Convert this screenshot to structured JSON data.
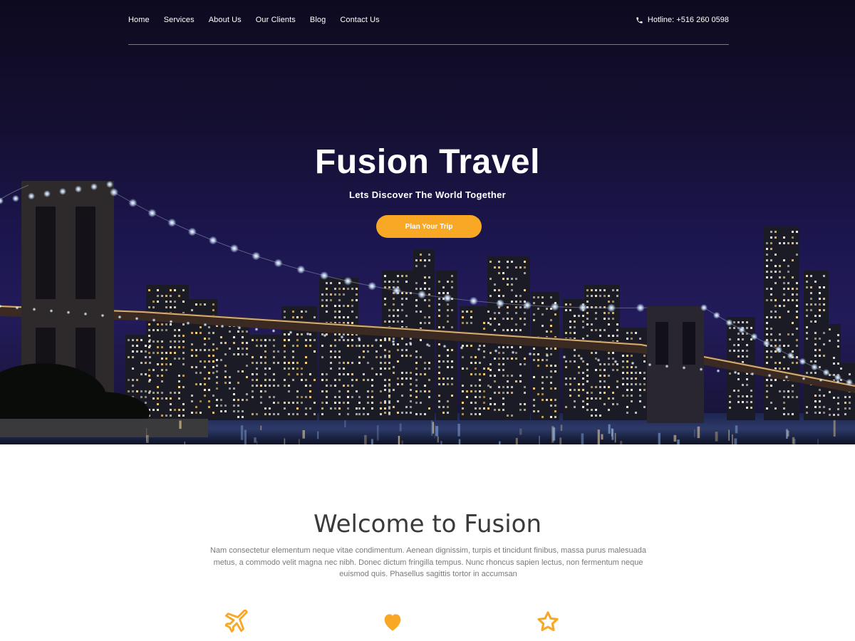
{
  "nav": {
    "items": [
      "Home",
      "Services",
      "About Us",
      "Our Clients",
      "Blog",
      "Contact Us"
    ],
    "hotline": "Hotline: +516 260 0598"
  },
  "hero": {
    "title": "Fusion Travel",
    "subtitle": "Lets Discover The World Together",
    "cta_label": "Plan Your Trip"
  },
  "welcome": {
    "title": "Welcome to Fusion",
    "text": "Nam consectetur elementum neque vitae condimentum. Aenean dignissim, turpis et tincidunt finibus, massa purus malesuada metus, a commodo velit magna nec nibh. Donec dictum fringilla tempus. Nunc rhoncus sapien lectus, non fermentum neque euismod quis. Phasellus sagittis tortor in accumsan"
  },
  "features": [
    {
      "icon": "airplane-icon"
    },
    {
      "icon": "heart-icon"
    },
    {
      "icon": "star-icon"
    }
  ],
  "colors": {
    "accent": "#f9a825",
    "hero_bg": "#1c1650",
    "text_dark": "#3a3a3a",
    "text_muted": "#7a7a7a"
  }
}
